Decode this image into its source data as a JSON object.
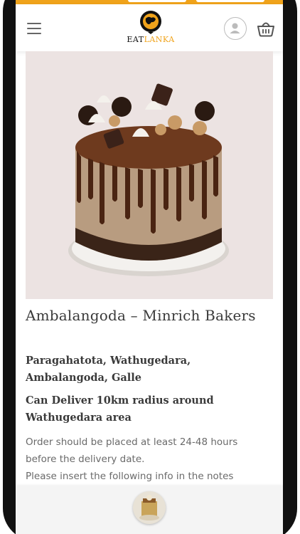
{
  "header": {
    "logo": {
      "eat": "EAT",
      "lanka": "LANKA"
    },
    "icons": {
      "menu": "hamburger-menu-icon",
      "account": "user-account-icon",
      "cart": "shopping-basket-icon"
    }
  },
  "product": {
    "title": "Ambalangoda – Minrich Bakers",
    "address": "Paragahatota, Wathugedara, Ambalangoda, Galle",
    "delivery": "Can Deliver 10km radius around Wathugedara area",
    "note_line_1": "Order should be placed at least 24-48 hours",
    "note_line_2": "before the delivery date.",
    "note_line_3": "Please insert the following info in the notes",
    "image": "chocolate-drip-cake-image"
  },
  "colors": {
    "accent": "#f0a31b",
    "text": "#3a3a3a",
    "muted": "#6a6a6a",
    "image_bg": "#ece3e2"
  }
}
